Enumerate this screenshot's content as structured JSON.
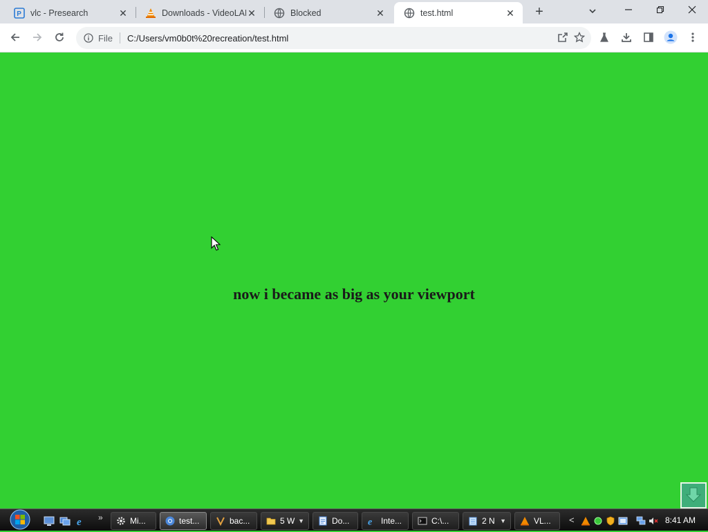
{
  "browser": {
    "tabs": [
      {
        "title": "vlc - Presearch",
        "icon": "presearch-icon",
        "active": false
      },
      {
        "title": "Downloads - VideoLAN",
        "icon": "vlc-cone-icon",
        "active": false
      },
      {
        "title": "Blocked",
        "icon": "globe-icon",
        "active": false
      },
      {
        "title": "test.html",
        "icon": "globe-icon",
        "active": true
      }
    ],
    "tab_close_glyph": "✕",
    "new_tab_glyph": "+",
    "window_controls": {
      "minimize_glyph": "─",
      "restore_glyph": "❐",
      "close_glyph": "✕"
    },
    "omnibox": {
      "scheme_label": "File",
      "url": "C:/Users/vm0b0t%20recreation/test.html"
    },
    "accent_color": "#1a73e8"
  },
  "page": {
    "heading": "now i became as big as your viewport",
    "background_color": "#32d032"
  },
  "taskbar": {
    "tasks": [
      {
        "label": "Mi...",
        "icon": "gear-icon",
        "has_dropdown": false,
        "active": false
      },
      {
        "label": "test...",
        "icon": "chrome-icon",
        "has_dropdown": false,
        "active": true
      },
      {
        "label": "bac...",
        "icon": "app-icon",
        "has_dropdown": false,
        "active": false
      },
      {
        "label": "5 W",
        "icon": "folder-icon",
        "has_dropdown": true,
        "active": false
      },
      {
        "label": "Do...",
        "icon": "document-icon",
        "has_dropdown": false,
        "active": false
      },
      {
        "label": "Inte...",
        "icon": "internet-explorer-icon",
        "has_dropdown": false,
        "active": false
      },
      {
        "label": "C:\\...",
        "icon": "command-prompt-icon",
        "has_dropdown": false,
        "active": false
      },
      {
        "label": "2 N",
        "icon": "notepad-icon",
        "has_dropdown": true,
        "active": false
      },
      {
        "label": "VL...",
        "icon": "vlc-cone-icon",
        "has_dropdown": false,
        "active": false
      }
    ],
    "quicklaunch_more": "»",
    "tray_chevron": "<",
    "clock": "8:41 AM"
  }
}
